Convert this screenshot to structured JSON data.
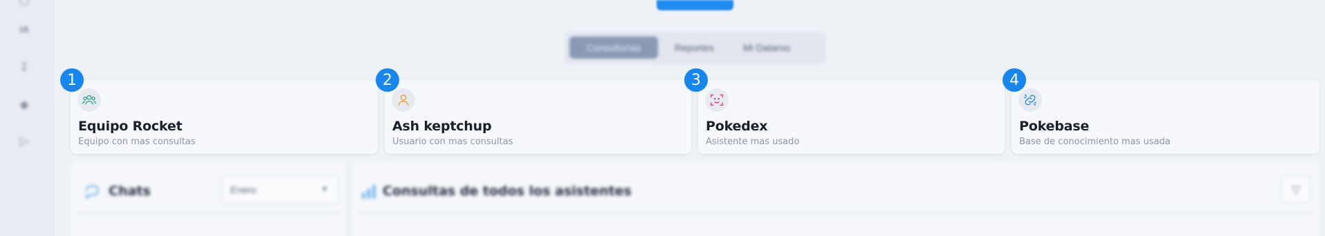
{
  "rail": {
    "icons": [
      "user-icon",
      "ia-icon",
      "download-icon",
      "diamond-icon",
      "play-icon"
    ],
    "ia_label": "IA"
  },
  "tabs": {
    "items": [
      "Consultorías",
      "Reportes",
      "Mi Dataroo"
    ]
  },
  "cards": [
    {
      "marker": "1",
      "icon": "team-icon",
      "title": "Equipo Rocket",
      "subtitle": "Equipo con mas consultas",
      "icon_color": "#3aa889"
    },
    {
      "marker": "2",
      "icon": "user-icon",
      "title": "Ash keptchup",
      "subtitle": "Usuario con mas consultas",
      "icon_color": "#f29a35"
    },
    {
      "marker": "3",
      "icon": "face-scan-icon",
      "title": "Pokedex",
      "subtitle": "Asistente mas usado",
      "icon_color": "#e2447a"
    },
    {
      "marker": "4",
      "icon": "link-icon",
      "title": "Pokebase",
      "subtitle": "Base de conocimiento mas usada",
      "icon_color": "#2b8ee6"
    }
  ],
  "panels": {
    "chats": {
      "title": "Chats",
      "select_value": "Enero"
    },
    "consultas": {
      "title": "Consultas de todos los asistentes"
    }
  },
  "colors": {
    "accent": "#1786ee",
    "background": "#eef1f6"
  }
}
